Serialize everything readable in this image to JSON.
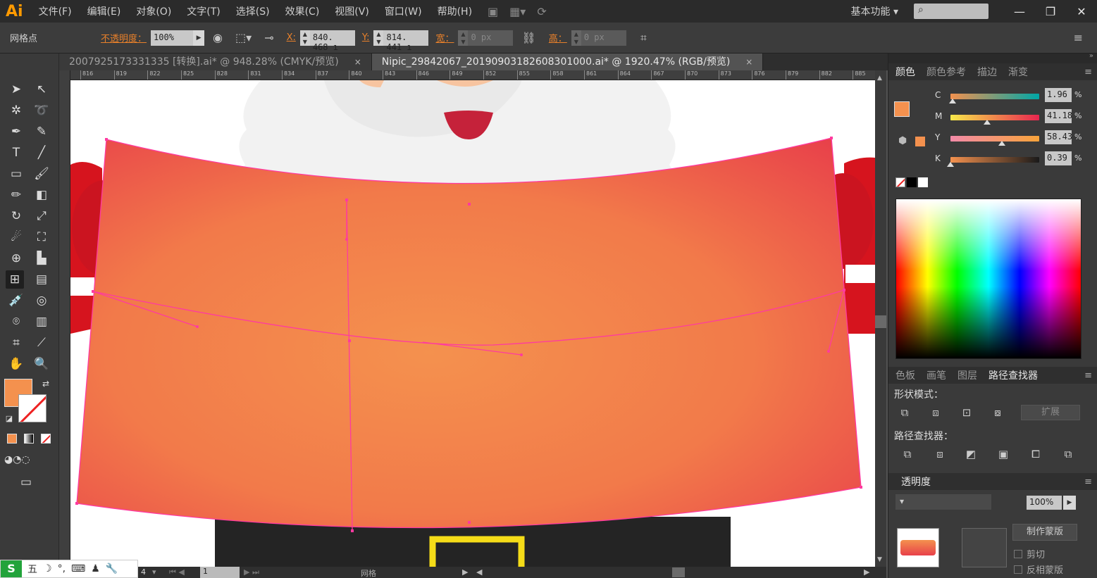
{
  "app": {
    "logo": "Ai"
  },
  "menu": [
    "文件(F)",
    "编辑(E)",
    "对象(O)",
    "文字(T)",
    "选择(S)",
    "效果(C)",
    "视图(V)",
    "窗口(W)",
    "帮助(H)"
  ],
  "menubar_right": {
    "workspace": "基本功能",
    "search_icon": "search-icon",
    "buttons": [
      "—",
      "❐",
      "✕"
    ]
  },
  "control_bar": {
    "object_type": "网格点",
    "opacity_label": "不透明度：",
    "opacity_value": "100%",
    "x_label": "X:",
    "x_value": "840. 468 ı",
    "y_label": "Y:",
    "y_value": "814. 441 ı",
    "width_label": "宽：",
    "width_value": "0 px",
    "height_label": "高：",
    "height_value": "0 px"
  },
  "doc_tabs": [
    {
      "title": "2007925173331335 [转换].ai* @ 948.28% (CMYK/预览)",
      "close": "×",
      "active": false
    },
    {
      "title": "Nipic_29842067_20190903182608301000.ai* @ 1920.47% (RGB/预览)",
      "close": "×",
      "active": true
    }
  ],
  "ruler_ticks": [
    "816",
    "819",
    "822",
    "825",
    "828",
    "831",
    "834",
    "837",
    "840",
    "843",
    "846",
    "849",
    "852",
    "855",
    "858",
    "861",
    "864",
    "867",
    "870",
    "873",
    "876",
    "879",
    "882",
    "885"
  ],
  "color_panel": {
    "tabs": [
      "颜色",
      "颜色参考",
      "描边",
      "渐变"
    ],
    "fill_color": "#f4914e",
    "channels": [
      {
        "label": "C",
        "value": "1.96",
        "fraction": 0.02
      },
      {
        "label": "M",
        "value": "41.18",
        "fraction": 0.41
      },
      {
        "label": "Y",
        "value": "58.43",
        "fraction": 0.58
      },
      {
        "label": "K",
        "value": "0.39",
        "fraction": 0.0
      }
    ],
    "pct": "%"
  },
  "pathfinder_panel": {
    "tabs": [
      "色板",
      "画笔",
      "图层",
      "路径查找器"
    ],
    "shape_modes_label": "形状模式：",
    "expand_label": "扩展",
    "pathfinders_label": "路径查找器："
  },
  "transparency_panel": {
    "tab": "透明度",
    "opacity_value": "100%",
    "make_mask_label": "制作蒙版",
    "clip_label": "剪切",
    "invert_label": "反相蒙版"
  },
  "status_bar": {
    "zoom": "4",
    "page": "1",
    "label": "网格"
  },
  "ime_bar": {
    "logo": "S",
    "items": [
      "五",
      "☽",
      "°,",
      "⌨",
      "♟",
      "🔧"
    ]
  }
}
